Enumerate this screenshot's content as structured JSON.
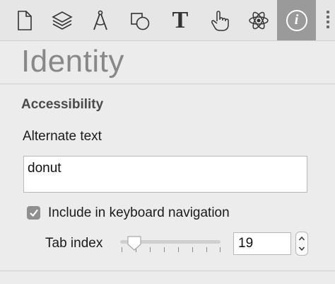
{
  "toolbar": {
    "tools": [
      {
        "name": "document-icon",
        "active": false
      },
      {
        "name": "layers-icon",
        "active": false
      },
      {
        "name": "compass-icon",
        "active": false
      },
      {
        "name": "shapes-icon",
        "active": false
      },
      {
        "name": "text-icon",
        "active": false
      },
      {
        "name": "hand-pointer-icon",
        "active": false
      },
      {
        "name": "atom-icon",
        "active": false
      },
      {
        "name": "info-icon",
        "active": true
      }
    ],
    "text_tool_glyph": "T",
    "info_tool_glyph": "i"
  },
  "inspector": {
    "title": "Identity"
  },
  "accessibility": {
    "section_title": "Accessibility",
    "alternate_text_label": "Alternate text",
    "alternate_text_value": "donut",
    "keyboard_nav_label": "Include in keyboard navigation",
    "keyboard_nav_checked": true,
    "tab_index_label": "Tab index",
    "tab_index_value": "19",
    "slider_fraction": 0.14
  },
  "colors": {
    "active_tool_bg": "#9a9a9a",
    "panel_bg": "#ececec"
  }
}
